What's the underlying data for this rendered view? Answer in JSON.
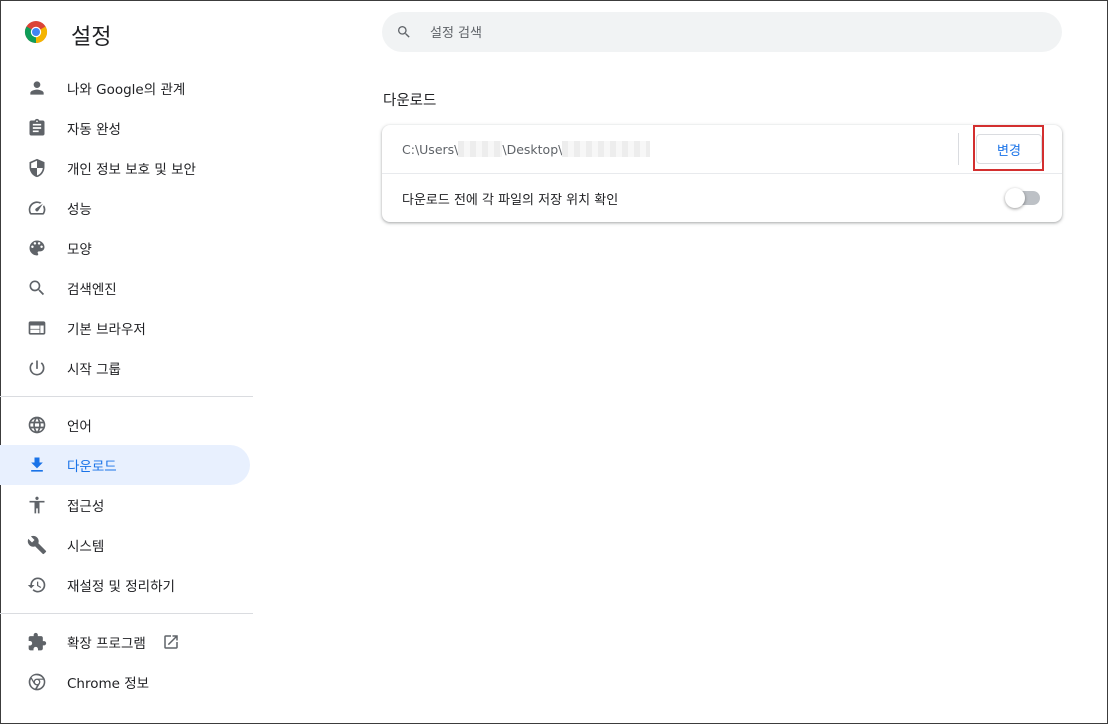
{
  "app": {
    "title": "설정"
  },
  "search": {
    "placeholder": "설정 검색"
  },
  "sidebar": {
    "items": [
      {
        "label": "나와 Google의 관계",
        "icon": "person-icon"
      },
      {
        "label": "자동 완성",
        "icon": "clipboard-icon"
      },
      {
        "label": "개인 정보 보호 및 보안",
        "icon": "shield-icon"
      },
      {
        "label": "성능",
        "icon": "speedometer-icon"
      },
      {
        "label": "모양",
        "icon": "palette-icon"
      },
      {
        "label": "검색엔진",
        "icon": "search-icon"
      },
      {
        "label": "기본 브라우저",
        "icon": "browser-icon"
      },
      {
        "label": "시작 그룹",
        "icon": "power-icon"
      },
      {
        "label": "언어",
        "icon": "globe-icon"
      },
      {
        "label": "다운로드",
        "icon": "download-icon",
        "active": true
      },
      {
        "label": "접근성",
        "icon": "accessibility-icon"
      },
      {
        "label": "시스템",
        "icon": "wrench-icon"
      },
      {
        "label": "재설정 및 정리하기",
        "icon": "history-icon"
      },
      {
        "label": "확장 프로그램",
        "icon": "puzzle-icon",
        "external_link_icon": "open-in-new-icon"
      },
      {
        "label": "Chrome 정보",
        "icon": "chrome-icon"
      }
    ]
  },
  "downloads": {
    "section_title": "다운로드",
    "path_prefix": "C:\\Users\\",
    "path_middle": "\\Desktop\\",
    "change_button": "변경",
    "ask_location_label": "다운로드 전에 각 파일의 저장 위치 확인",
    "ask_location_enabled": false
  },
  "colors": {
    "accent": "#1a73e8",
    "active_bg": "#e8f0fe",
    "highlight_box": "#d32f2f"
  }
}
